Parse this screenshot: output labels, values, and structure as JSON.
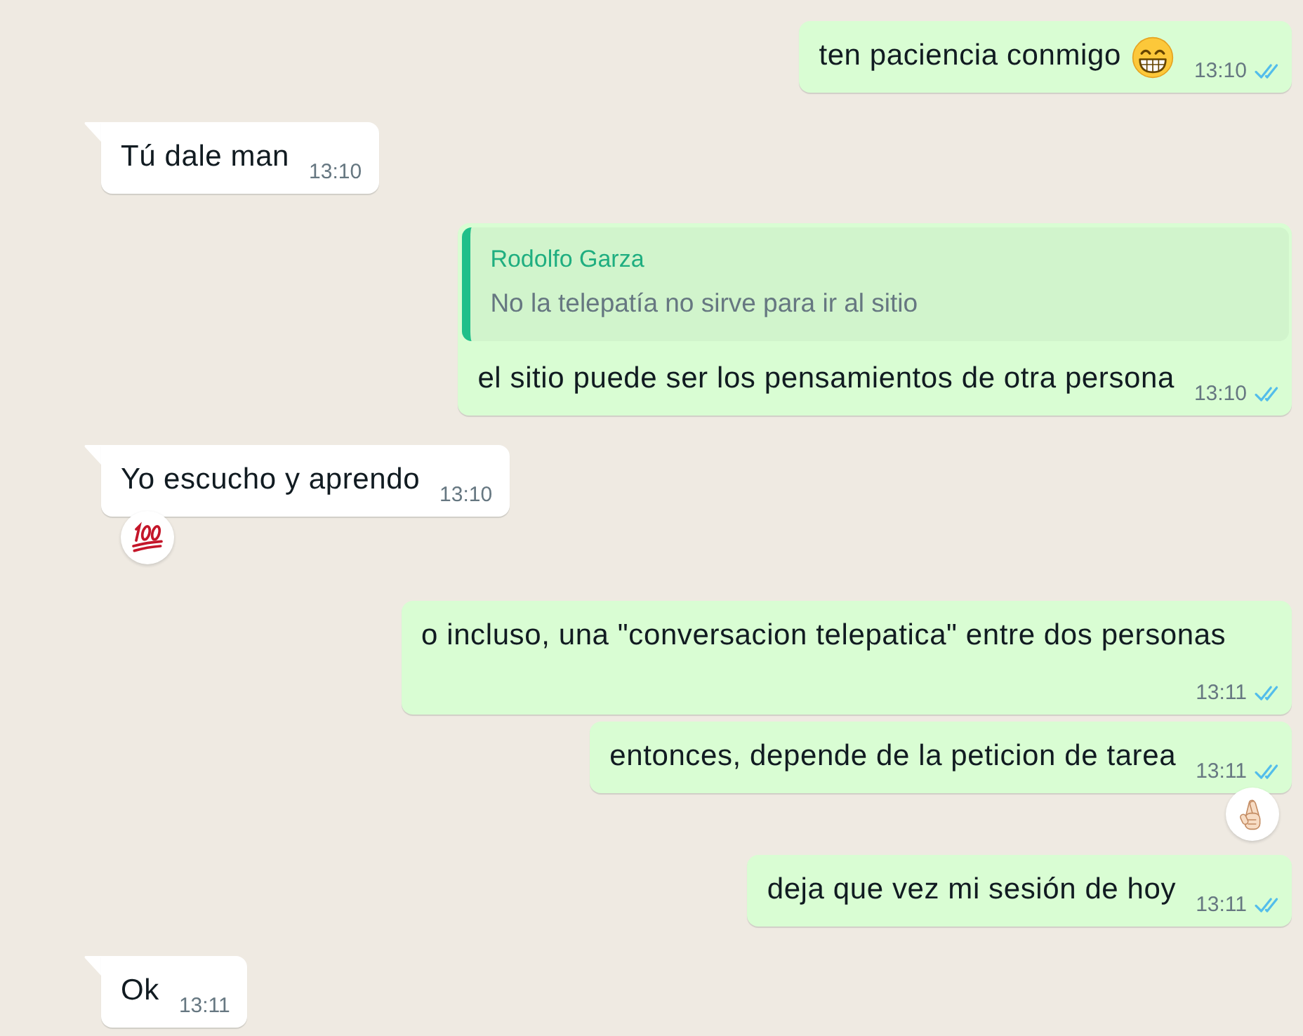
{
  "messages": [
    {
      "outgoing": true,
      "text": "ten paciencia conmigo",
      "emoji": {
        "kind": "grinning"
      },
      "time": "13:10",
      "read": true
    },
    {
      "outgoing": false,
      "text": "Tú dale man",
      "time": "13:10"
    },
    {
      "outgoing": true,
      "quote": {
        "author": "Rodolfo Garza",
        "text": "No la telepatía no sirve para ir al sitio"
      },
      "text": "el sitio puede ser los pensamientos de otra persona",
      "time": "13:10",
      "read": true
    },
    {
      "outgoing": false,
      "text": "Yo escucho y aprendo",
      "time": "13:10",
      "reaction": {
        "kind": "hundred"
      }
    },
    {
      "outgoing": true,
      "text": "o incluso, una \"conversacion telepatica\" entre dos personas",
      "time": "13:11",
      "read": true
    },
    {
      "outgoing": true,
      "text": "entonces, depende de la peticion de tarea",
      "time": "13:11",
      "read": true,
      "reaction": {
        "kind": "crossed_fingers"
      }
    },
    {
      "outgoing": true,
      "text": "deja que vez mi sesión de hoy",
      "time": "13:11",
      "read": true
    },
    {
      "outgoing": false,
      "text": "Ok",
      "time": "13:11"
    }
  ]
}
